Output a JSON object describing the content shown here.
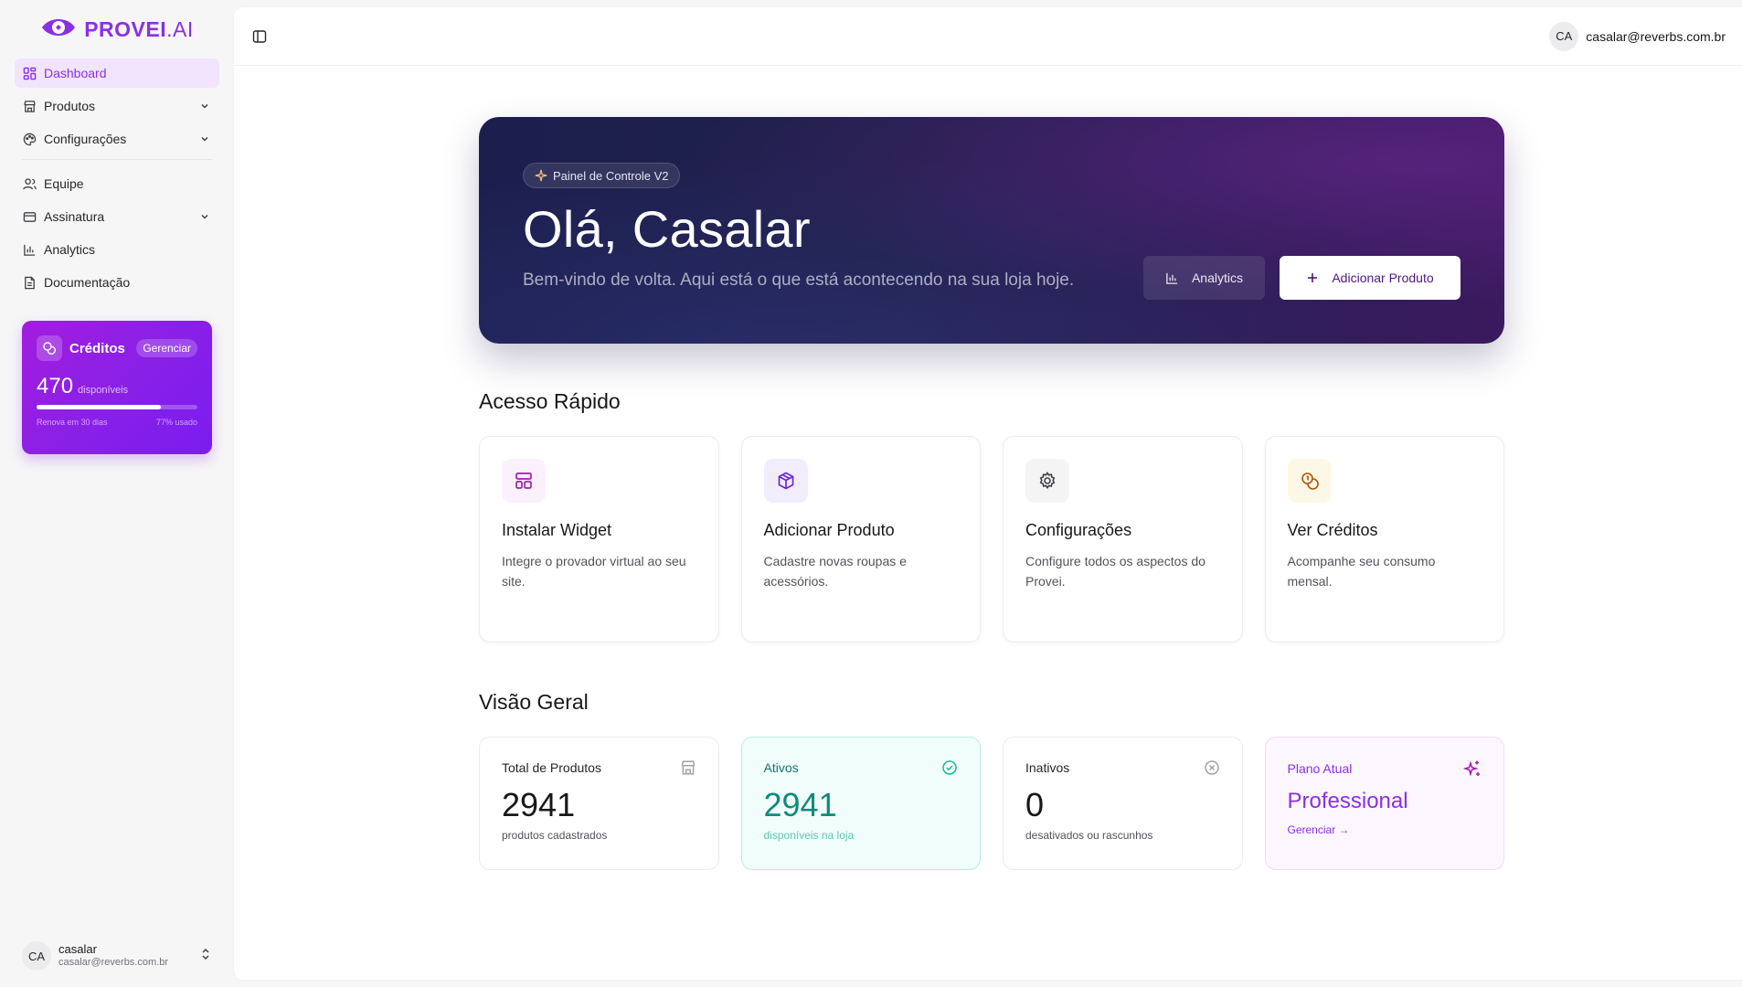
{
  "brand": {
    "name": "PROVEI",
    "suffix": ".AI",
    "color": "#8b2fe3"
  },
  "sidebar": {
    "items": [
      {
        "label": "Dashboard",
        "icon": "dashboard-icon",
        "active": true
      },
      {
        "label": "Produtos",
        "icon": "store-icon",
        "expandable": true
      },
      {
        "label": "Configurações",
        "icon": "palette-icon",
        "expandable": true
      },
      {
        "label": "Equipe",
        "icon": "users-icon"
      },
      {
        "label": "Assinatura",
        "icon": "credit-card-icon",
        "expandable": true
      },
      {
        "label": "Analytics",
        "icon": "bar-chart-icon"
      },
      {
        "label": "Documentação",
        "icon": "file-icon"
      }
    ],
    "credits": {
      "title": "Créditos",
      "manage": "Gerenciar",
      "amount": "470",
      "amount_label": "disponíveis",
      "renew": "Renova em 30 dias",
      "used_label": "77% usado",
      "used_fraction": 0.77
    },
    "user": {
      "initials": "CA",
      "name": "casalar",
      "email": "casalar@reverbs.com.br"
    }
  },
  "topbar": {
    "initials": "CA",
    "email": "casalar@reverbs.com.br"
  },
  "hero": {
    "badge": "Painel de Controle V2",
    "greeting": "Olá, Casalar",
    "subtitle": "Bem-vindo de volta. Aqui está o que está acontecendo na sua loja hoje.",
    "analytics_button": "Analytics",
    "add_button": "Adicionar Produto"
  },
  "quick_access": {
    "title": "Acesso Rápido",
    "cards": [
      {
        "title": "Instalar Widget",
        "desc": "Integre o provador virtual ao seu site.",
        "icon": "layout-icon",
        "color": "#a21caf",
        "bg": "#fbf0fe"
      },
      {
        "title": "Adicionar Produto",
        "desc": "Cadastre novas roupas e acessórios.",
        "icon": "package-icon",
        "color": "#6d28d9",
        "bg": "#f1edfd"
      },
      {
        "title": "Configurações",
        "desc": "Configure todos os aspectos do Provei.",
        "icon": "gear-icon",
        "color": "#3f3f46",
        "bg": "#f4f4f5"
      },
      {
        "title": "Ver Créditos",
        "desc": "Acompanhe seu consumo mensal.",
        "icon": "coins-icon",
        "color": "#b45309",
        "bg": "#fdf8e6"
      }
    ]
  },
  "overview": {
    "title": "Visão Geral",
    "stats": [
      {
        "label": "Total de Produtos",
        "value": "2941",
        "sub": "produtos cadastrados",
        "icon": "store-icon"
      },
      {
        "label": "Ativos",
        "value": "2941",
        "sub": "disponíveis na loja",
        "icon": "check-circle-icon"
      },
      {
        "label": "Inativos",
        "value": "0",
        "sub": "desativados ou rascunhos",
        "icon": "x-circle-icon"
      }
    ],
    "plan": {
      "label": "Plano Atual",
      "value": "Professional",
      "link": "Gerenciar →",
      "icon": "sparkles-icon"
    }
  }
}
